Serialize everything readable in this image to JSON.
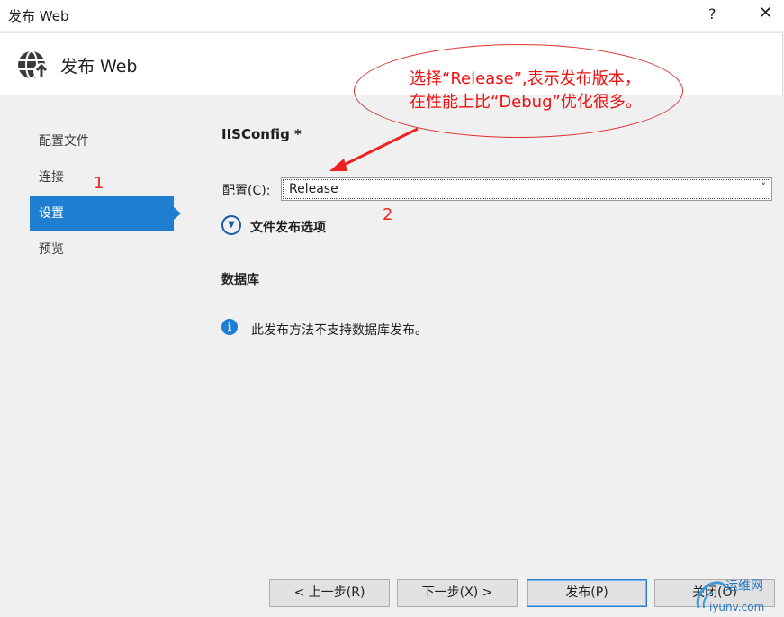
{
  "window": {
    "title": "发布 Web",
    "help": "?",
    "close": "✕"
  },
  "header": {
    "title": "发布 Web",
    "icon": "globe-icon"
  },
  "sidebar": {
    "items": [
      {
        "label": "配置文件"
      },
      {
        "label": "连接"
      },
      {
        "label": "设置"
      },
      {
        "label": "预览"
      }
    ],
    "active_index": 2
  },
  "annotations": {
    "num1": "1",
    "num2": "2",
    "callout_line1": "选择“Release”,表示发布版本，",
    "callout_line2": "在性能上比“Debug”优化很多。"
  },
  "settings": {
    "profile_title": "IISConfig *",
    "config_label": "配置(C):",
    "config_value": "Release",
    "file_options_label": "文件发布选项"
  },
  "database": {
    "title": "数据库",
    "info_text": "此发布方法不支持数据库发布。"
  },
  "footer": {
    "prev": "< 上一步(R)",
    "next": "下一步(X) >",
    "publish": "发布(P)",
    "close": "关闭(O)"
  },
  "watermark": {
    "line1": "运维网",
    "line2": "iyunv.com"
  },
  "colors": {
    "accent": "#1e7fd2",
    "annotation": "#e22222"
  }
}
